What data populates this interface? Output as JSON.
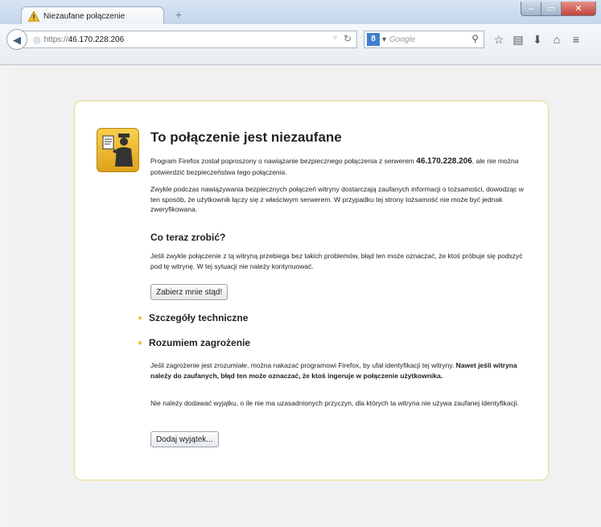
{
  "browser": {
    "tab_title": "Niezaufane połączenie",
    "new_tab_symbol": "+",
    "url_scheme": "https://",
    "url_host": "46.170.228.206",
    "search_placeholder": "Google",
    "search_engine_letter": "8",
    "window_buttons": {
      "minimize": "–",
      "maximize": "▭",
      "close": "✕"
    }
  },
  "toolbar_icons": [
    "star-icon",
    "bookmarks-list-icon",
    "download-icon",
    "home-icon",
    "menu-icon"
  ],
  "error": {
    "title": "To połączenie jest niezaufane",
    "intro_prefix": "Program Firefox został poproszony o nawiązanie bezpiecznego połączenia z serwerem ",
    "intro_host": "46.170.228.206",
    "intro_suffix": ", ale nie można potwierdzić bezpieczeństwa tego połączenia.",
    "explanation": "Zwykle podczas nawiązywania bezpiecznych połączeń witryny dostarczają zaufanych informacji o tożsamości, dowodząc w ten sposób, że użytkownik łączy się z właściwym serwerem. W przypadku tej strony tożsamość nie może być jednak zweryfikowana.",
    "what_to_do_heading": "Co teraz zrobić?",
    "what_to_do_text": "Jeśli zwykle połączenie z tą witryną przebiega bez takich problemów, błąd ten może oznaczać, że ktoś próbuje się podszyć pod tę witrynę. W tej sytuacji nie należy kontynuować.",
    "get_me_out_button": "Zabierz mnie stąd!",
    "technical_details": "Szczegóły techniczne",
    "understand_risks": "Rozumiem zagrożenie",
    "risk_text_plain": "Jeśli zagrożenie jest zrozumiałe, można nakazać programowi Firefox, by ufał identyfikacji tej witryny. ",
    "risk_text_bold": "Nawet jeśli witryna należy do zaufanych, błąd ten może oznaczać, że ktoś ingeruje w połączenie użytkownika.",
    "exception_advice": "Nie należy dodawać wyjątku, o ile nie ma uzasadnionych przyczyn, dla których ta witryna nie używa zaufanej identyfikacji.",
    "add_exception_button": "Dodaj wyjątek..."
  },
  "colors": {
    "accent": "#f2c43a",
    "icon_yellow": "#f8cf4e",
    "box_border": "#e6dcaa"
  }
}
